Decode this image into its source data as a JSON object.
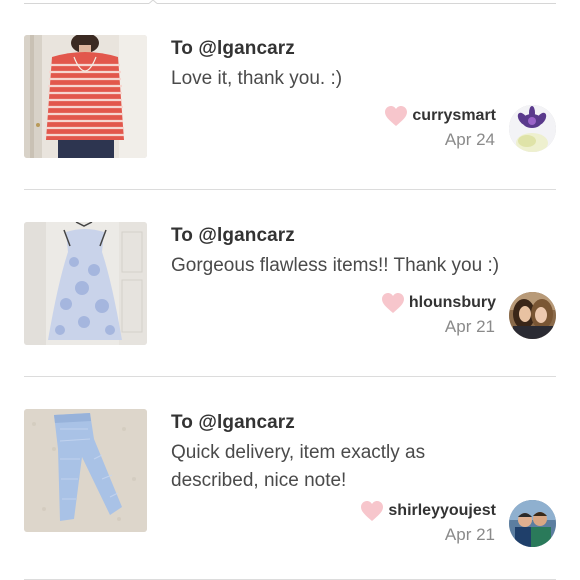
{
  "reviews": [
    {
      "to": "To @lgancarz",
      "comment": "Love it, thank you. :)",
      "username": "currysmart",
      "date": "Apr 24",
      "thumbnail": "red-striped-top-photo",
      "avatar": "flower-avatar"
    },
    {
      "to": "To @lgancarz",
      "comment": "Gorgeous flawless items!! Thank you :)",
      "username": "hlounsbury",
      "date": "Apr 21",
      "thumbnail": "blue-floral-dress-photo",
      "avatar": "two-women-avatar"
    },
    {
      "to": "To @lgancarz",
      "comment": "Quick delivery, item exactly as described, nice note!",
      "username": "shirleyyoujest",
      "date": "Apr 21",
      "thumbnail": "light-blue-pants-photo",
      "avatar": "family-avatar"
    }
  ],
  "colors": {
    "heart": "#f7c6cc",
    "divider": "#dcdcdc",
    "muted_text": "#8a8a8a"
  },
  "icons": {
    "heart": "heart-icon"
  }
}
